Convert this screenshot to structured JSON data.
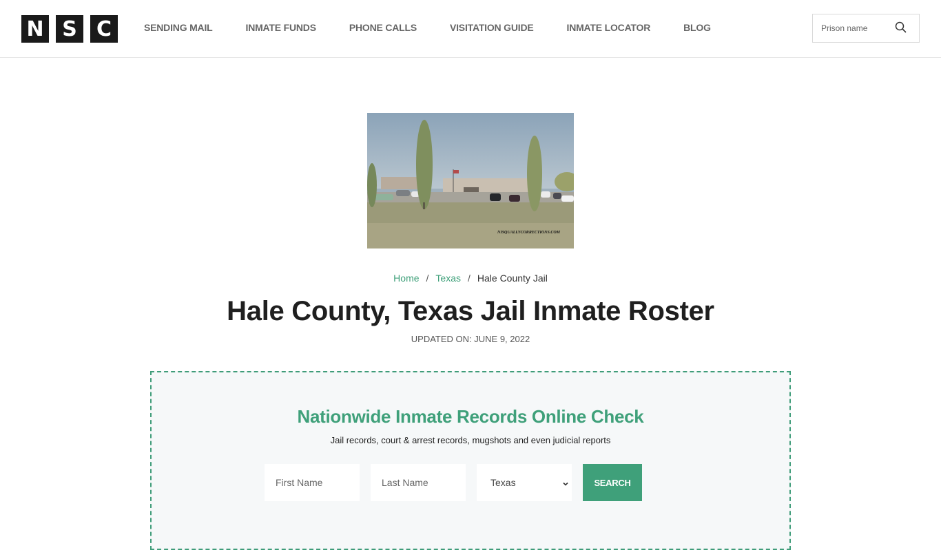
{
  "header": {
    "logo_letters": [
      "N",
      "S",
      "C"
    ],
    "nav": [
      {
        "label": "SENDING MAIL"
      },
      {
        "label": "INMATE FUNDS"
      },
      {
        "label": "PHONE CALLS"
      },
      {
        "label": "VISITATION GUIDE"
      },
      {
        "label": "INMATE LOCATOR"
      },
      {
        "label": "BLOG"
      }
    ],
    "search": {
      "placeholder": "Prison name",
      "value": "",
      "icon": "search-icon"
    }
  },
  "hero": {
    "alt": "Hale County Jail building",
    "watermark": "NISQUALLYCORRECTIONS.COM"
  },
  "breadcrumb": [
    {
      "label": "Home",
      "link": true
    },
    {
      "label": "Texas",
      "link": true
    },
    {
      "label": "Hale County Jail",
      "link": false
    }
  ],
  "breadcrumb_separator": "/",
  "page": {
    "title": "Hale County, Texas Jail Inmate Roster",
    "updated": "UPDATED ON: JUNE 9, 2022"
  },
  "panel": {
    "title": "Nationwide Inmate Records Online Check",
    "subtitle": "Jail records, court & arrest records, mugshots and even judicial reports",
    "first_name": {
      "placeholder": "First Name",
      "value": ""
    },
    "last_name": {
      "placeholder": "Last Name",
      "value": ""
    },
    "state": {
      "selected": "Texas"
    },
    "search_label": "SEARCH"
  },
  "colors": {
    "accent": "#3fa07a",
    "logo_bg": "#1a1a1a",
    "panel_bg": "#f6f8f9"
  }
}
